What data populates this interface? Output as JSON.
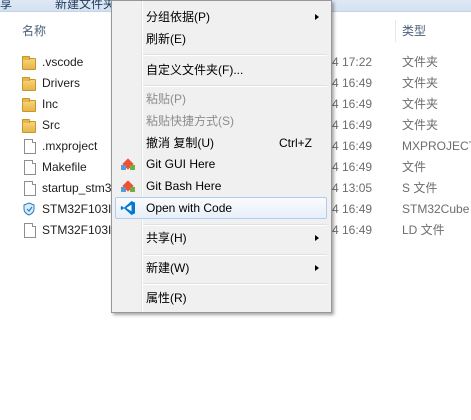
{
  "toolbar": {
    "left_label": "享",
    "new_folder_label": "新建文件夹"
  },
  "header": {
    "name_col": "名称",
    "type_col": "类型"
  },
  "files": [
    {
      "name": ".vscode",
      "date": "4 17:22",
      "type": "文件夹",
      "icon": "folder-icon"
    },
    {
      "name": "Drivers",
      "date": "4 16:49",
      "type": "文件夹",
      "icon": "folder-icon"
    },
    {
      "name": "Inc",
      "date": "4 16:49",
      "type": "文件夹",
      "icon": "folder-icon"
    },
    {
      "name": "Src",
      "date": "4 16:49",
      "type": "文件夹",
      "icon": "folder-icon"
    },
    {
      "name": ".mxproject",
      "date": "4 16:49",
      "type": "MXPROJECT",
      "icon": "file-icon"
    },
    {
      "name": "Makefile",
      "date": "4 16:49",
      "type": "文件",
      "icon": "file-icon"
    },
    {
      "name": "startup_stm3",
      "date": "4 13:05",
      "type": "S 文件",
      "icon": "file-icon"
    },
    {
      "name": "STM32F103I",
      "date": "4 16:49",
      "type": "STM32Cube",
      "icon": "shield-icon"
    },
    {
      "name": "STM32F103I",
      "date": "4 16:49",
      "type": "LD 文件",
      "icon": "file-icon"
    }
  ],
  "menu": {
    "group_by": "分组依据(P)",
    "refresh": "刷新(E)",
    "customize_folder": "自定义文件夹(F)...",
    "paste": "粘贴(P)",
    "paste_shortcut": "粘贴快捷方式(S)",
    "undo_copy": "撤消 复制(U)",
    "undo_shortcut": "Ctrl+Z",
    "git_gui": "Git GUI Here",
    "git_bash": "Git Bash Here",
    "open_with_code": "Open with Code",
    "share": "共享(H)",
    "new": "新建(W)",
    "properties": "属性(R)"
  },
  "colors": {
    "highlight_border": "#aeccf0",
    "menu_bg": "#f0f0f0",
    "vscode_blue": "#0078d4",
    "git_red": "#f05133"
  }
}
